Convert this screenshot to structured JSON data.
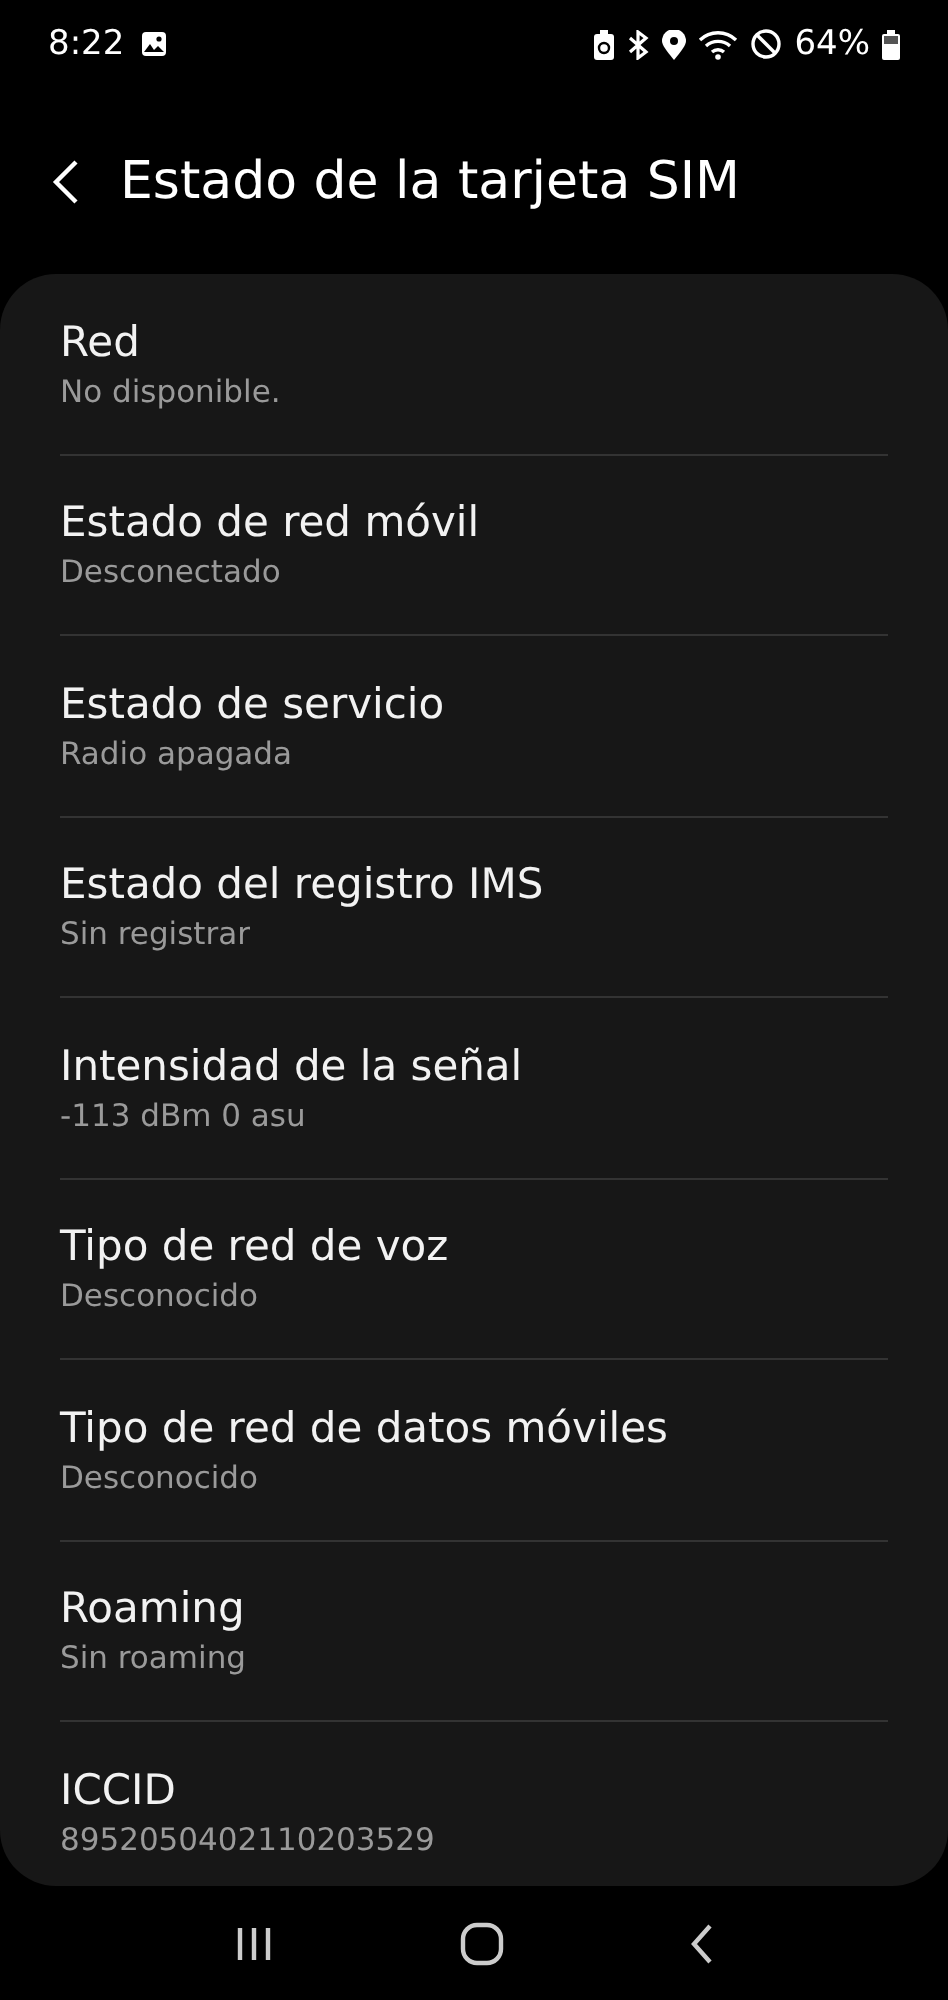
{
  "status_bar": {
    "time": "8:22",
    "battery": "64%"
  },
  "header": {
    "title": "Estado de la tarjeta SIM"
  },
  "items": [
    {
      "title": "Red",
      "value": "No disponible."
    },
    {
      "title": "Estado de red móvil",
      "value": "Desconectado"
    },
    {
      "title": "Estado de servicio",
      "value": "Radio apagada"
    },
    {
      "title": "Estado del registro IMS",
      "value": "Sin registrar"
    },
    {
      "title": "Intensidad de la señal",
      "value": "-113 dBm 0 asu"
    },
    {
      "title": "Tipo de red de voz",
      "value": "Desconocido"
    },
    {
      "title": "Tipo de red de datos móviles",
      "value": "Desconocido"
    },
    {
      "title": "Roaming",
      "value": "Sin roaming"
    },
    {
      "title": "ICCID",
      "value": "8952050402110203529"
    }
  ]
}
